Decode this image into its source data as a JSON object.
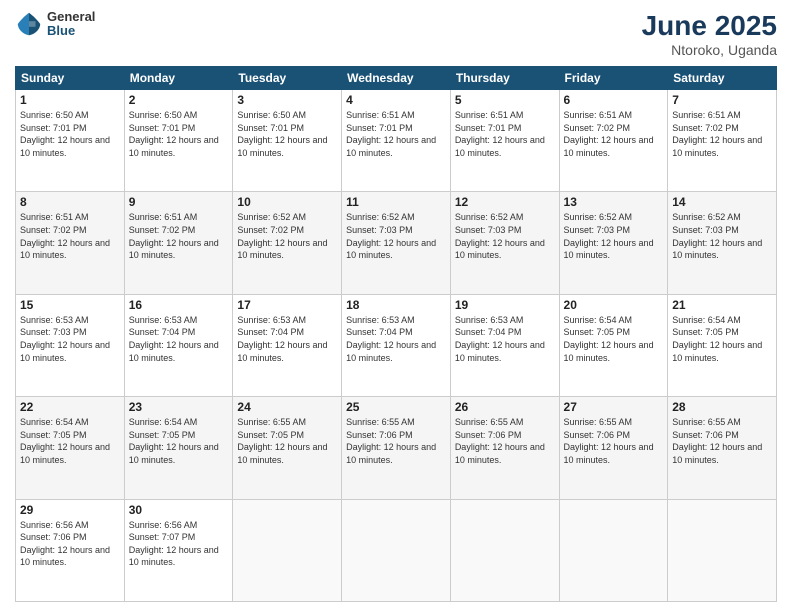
{
  "header": {
    "logo_general": "General",
    "logo_blue": "Blue",
    "month_title": "June 2025",
    "location": "Ntoroko, Uganda"
  },
  "days_of_week": [
    "Sunday",
    "Monday",
    "Tuesday",
    "Wednesday",
    "Thursday",
    "Friday",
    "Saturday"
  ],
  "weeks": [
    [
      {
        "day": "1",
        "sunrise": "6:50 AM",
        "sunset": "7:01 PM",
        "daylight": "12 hours and 10 minutes."
      },
      {
        "day": "2",
        "sunrise": "6:50 AM",
        "sunset": "7:01 PM",
        "daylight": "12 hours and 10 minutes."
      },
      {
        "day": "3",
        "sunrise": "6:50 AM",
        "sunset": "7:01 PM",
        "daylight": "12 hours and 10 minutes."
      },
      {
        "day": "4",
        "sunrise": "6:51 AM",
        "sunset": "7:01 PM",
        "daylight": "12 hours and 10 minutes."
      },
      {
        "day": "5",
        "sunrise": "6:51 AM",
        "sunset": "7:01 PM",
        "daylight": "12 hours and 10 minutes."
      },
      {
        "day": "6",
        "sunrise": "6:51 AM",
        "sunset": "7:02 PM",
        "daylight": "12 hours and 10 minutes."
      },
      {
        "day": "7",
        "sunrise": "6:51 AM",
        "sunset": "7:02 PM",
        "daylight": "12 hours and 10 minutes."
      }
    ],
    [
      {
        "day": "8",
        "sunrise": "6:51 AM",
        "sunset": "7:02 PM",
        "daylight": "12 hours and 10 minutes."
      },
      {
        "day": "9",
        "sunrise": "6:51 AM",
        "sunset": "7:02 PM",
        "daylight": "12 hours and 10 minutes."
      },
      {
        "day": "10",
        "sunrise": "6:52 AM",
        "sunset": "7:02 PM",
        "daylight": "12 hours and 10 minutes."
      },
      {
        "day": "11",
        "sunrise": "6:52 AM",
        "sunset": "7:03 PM",
        "daylight": "12 hours and 10 minutes."
      },
      {
        "day": "12",
        "sunrise": "6:52 AM",
        "sunset": "7:03 PM",
        "daylight": "12 hours and 10 minutes."
      },
      {
        "day": "13",
        "sunrise": "6:52 AM",
        "sunset": "7:03 PM",
        "daylight": "12 hours and 10 minutes."
      },
      {
        "day": "14",
        "sunrise": "6:52 AM",
        "sunset": "7:03 PM",
        "daylight": "12 hours and 10 minutes."
      }
    ],
    [
      {
        "day": "15",
        "sunrise": "6:53 AM",
        "sunset": "7:03 PM",
        "daylight": "12 hours and 10 minutes."
      },
      {
        "day": "16",
        "sunrise": "6:53 AM",
        "sunset": "7:04 PM",
        "daylight": "12 hours and 10 minutes."
      },
      {
        "day": "17",
        "sunrise": "6:53 AM",
        "sunset": "7:04 PM",
        "daylight": "12 hours and 10 minutes."
      },
      {
        "day": "18",
        "sunrise": "6:53 AM",
        "sunset": "7:04 PM",
        "daylight": "12 hours and 10 minutes."
      },
      {
        "day": "19",
        "sunrise": "6:53 AM",
        "sunset": "7:04 PM",
        "daylight": "12 hours and 10 minutes."
      },
      {
        "day": "20",
        "sunrise": "6:54 AM",
        "sunset": "7:05 PM",
        "daylight": "12 hours and 10 minutes."
      },
      {
        "day": "21",
        "sunrise": "6:54 AM",
        "sunset": "7:05 PM",
        "daylight": "12 hours and 10 minutes."
      }
    ],
    [
      {
        "day": "22",
        "sunrise": "6:54 AM",
        "sunset": "7:05 PM",
        "daylight": "12 hours and 10 minutes."
      },
      {
        "day": "23",
        "sunrise": "6:54 AM",
        "sunset": "7:05 PM",
        "daylight": "12 hours and 10 minutes."
      },
      {
        "day": "24",
        "sunrise": "6:55 AM",
        "sunset": "7:05 PM",
        "daylight": "12 hours and 10 minutes."
      },
      {
        "day": "25",
        "sunrise": "6:55 AM",
        "sunset": "7:06 PM",
        "daylight": "12 hours and 10 minutes."
      },
      {
        "day": "26",
        "sunrise": "6:55 AM",
        "sunset": "7:06 PM",
        "daylight": "12 hours and 10 minutes."
      },
      {
        "day": "27",
        "sunrise": "6:55 AM",
        "sunset": "7:06 PM",
        "daylight": "12 hours and 10 minutes."
      },
      {
        "day": "28",
        "sunrise": "6:55 AM",
        "sunset": "7:06 PM",
        "daylight": "12 hours and 10 minutes."
      }
    ],
    [
      {
        "day": "29",
        "sunrise": "6:56 AM",
        "sunset": "7:06 PM",
        "daylight": "12 hours and 10 minutes."
      },
      {
        "day": "30",
        "sunrise": "6:56 AM",
        "sunset": "7:07 PM",
        "daylight": "12 hours and 10 minutes."
      },
      null,
      null,
      null,
      null,
      null
    ]
  ]
}
